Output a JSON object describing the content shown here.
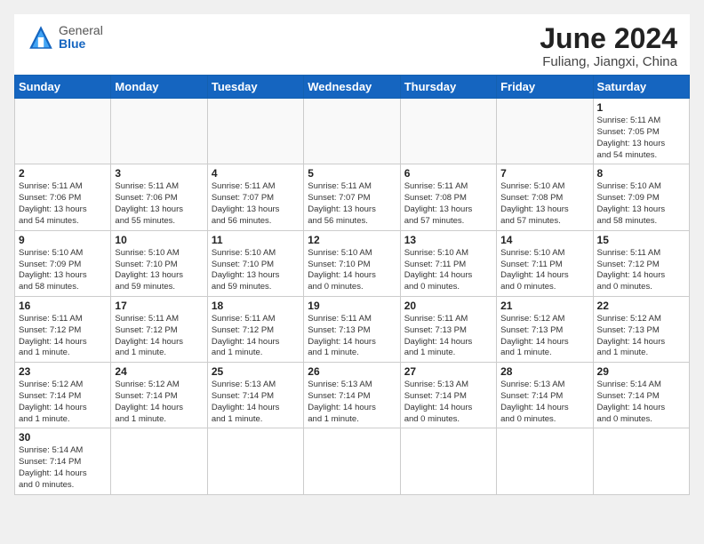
{
  "header": {
    "logo_general": "General",
    "logo_blue": "Blue",
    "month_title": "June 2024",
    "location": "Fuliang, Jiangxi, China"
  },
  "weekdays": [
    "Sunday",
    "Monday",
    "Tuesday",
    "Wednesday",
    "Thursday",
    "Friday",
    "Saturday"
  ],
  "days": [
    {
      "num": "",
      "info": ""
    },
    {
      "num": "",
      "info": ""
    },
    {
      "num": "",
      "info": ""
    },
    {
      "num": "",
      "info": ""
    },
    {
      "num": "",
      "info": ""
    },
    {
      "num": "",
      "info": ""
    },
    {
      "num": "1",
      "info": "Sunrise: 5:11 AM\nSunset: 7:05 PM\nDaylight: 13 hours\nand 54 minutes."
    },
    {
      "num": "2",
      "info": "Sunrise: 5:11 AM\nSunset: 7:06 PM\nDaylight: 13 hours\nand 54 minutes."
    },
    {
      "num": "3",
      "info": "Sunrise: 5:11 AM\nSunset: 7:06 PM\nDaylight: 13 hours\nand 55 minutes."
    },
    {
      "num": "4",
      "info": "Sunrise: 5:11 AM\nSunset: 7:07 PM\nDaylight: 13 hours\nand 56 minutes."
    },
    {
      "num": "5",
      "info": "Sunrise: 5:11 AM\nSunset: 7:07 PM\nDaylight: 13 hours\nand 56 minutes."
    },
    {
      "num": "6",
      "info": "Sunrise: 5:11 AM\nSunset: 7:08 PM\nDaylight: 13 hours\nand 57 minutes."
    },
    {
      "num": "7",
      "info": "Sunrise: 5:10 AM\nSunset: 7:08 PM\nDaylight: 13 hours\nand 57 minutes."
    },
    {
      "num": "8",
      "info": "Sunrise: 5:10 AM\nSunset: 7:09 PM\nDaylight: 13 hours\nand 58 minutes."
    },
    {
      "num": "9",
      "info": "Sunrise: 5:10 AM\nSunset: 7:09 PM\nDaylight: 13 hours\nand 58 minutes."
    },
    {
      "num": "10",
      "info": "Sunrise: 5:10 AM\nSunset: 7:10 PM\nDaylight: 13 hours\nand 59 minutes."
    },
    {
      "num": "11",
      "info": "Sunrise: 5:10 AM\nSunset: 7:10 PM\nDaylight: 13 hours\nand 59 minutes."
    },
    {
      "num": "12",
      "info": "Sunrise: 5:10 AM\nSunset: 7:10 PM\nDaylight: 14 hours\nand 0 minutes."
    },
    {
      "num": "13",
      "info": "Sunrise: 5:10 AM\nSunset: 7:11 PM\nDaylight: 14 hours\nand 0 minutes."
    },
    {
      "num": "14",
      "info": "Sunrise: 5:10 AM\nSunset: 7:11 PM\nDaylight: 14 hours\nand 0 minutes."
    },
    {
      "num": "15",
      "info": "Sunrise: 5:11 AM\nSunset: 7:12 PM\nDaylight: 14 hours\nand 0 minutes."
    },
    {
      "num": "16",
      "info": "Sunrise: 5:11 AM\nSunset: 7:12 PM\nDaylight: 14 hours\nand 1 minute."
    },
    {
      "num": "17",
      "info": "Sunrise: 5:11 AM\nSunset: 7:12 PM\nDaylight: 14 hours\nand 1 minute."
    },
    {
      "num": "18",
      "info": "Sunrise: 5:11 AM\nSunset: 7:12 PM\nDaylight: 14 hours\nand 1 minute."
    },
    {
      "num": "19",
      "info": "Sunrise: 5:11 AM\nSunset: 7:13 PM\nDaylight: 14 hours\nand 1 minute."
    },
    {
      "num": "20",
      "info": "Sunrise: 5:11 AM\nSunset: 7:13 PM\nDaylight: 14 hours\nand 1 minute."
    },
    {
      "num": "21",
      "info": "Sunrise: 5:12 AM\nSunset: 7:13 PM\nDaylight: 14 hours\nand 1 minute."
    },
    {
      "num": "22",
      "info": "Sunrise: 5:12 AM\nSunset: 7:13 PM\nDaylight: 14 hours\nand 1 minute."
    },
    {
      "num": "23",
      "info": "Sunrise: 5:12 AM\nSunset: 7:14 PM\nDaylight: 14 hours\nand 1 minute."
    },
    {
      "num": "24",
      "info": "Sunrise: 5:12 AM\nSunset: 7:14 PM\nDaylight: 14 hours\nand 1 minute."
    },
    {
      "num": "25",
      "info": "Sunrise: 5:13 AM\nSunset: 7:14 PM\nDaylight: 14 hours\nand 1 minute."
    },
    {
      "num": "26",
      "info": "Sunrise: 5:13 AM\nSunset: 7:14 PM\nDaylight: 14 hours\nand 1 minute."
    },
    {
      "num": "27",
      "info": "Sunrise: 5:13 AM\nSunset: 7:14 PM\nDaylight: 14 hours\nand 0 minutes."
    },
    {
      "num": "28",
      "info": "Sunrise: 5:13 AM\nSunset: 7:14 PM\nDaylight: 14 hours\nand 0 minutes."
    },
    {
      "num": "29",
      "info": "Sunrise: 5:14 AM\nSunset: 7:14 PM\nDaylight: 14 hours\nand 0 minutes."
    },
    {
      "num": "30",
      "info": "Sunrise: 5:14 AM\nSunset: 7:14 PM\nDaylight: 14 hours\nand 0 minutes."
    }
  ]
}
